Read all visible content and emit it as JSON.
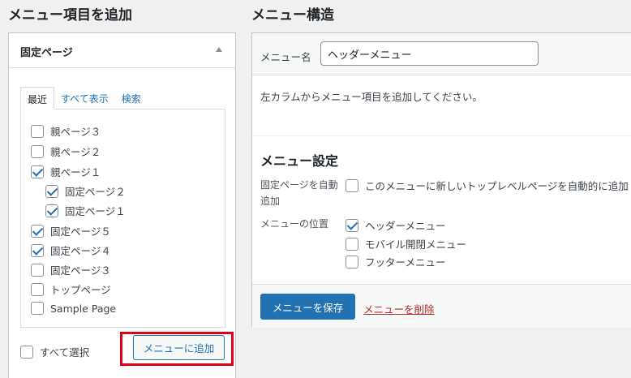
{
  "left": {
    "title": "メニュー項目を追加",
    "panel_title": "固定ページ",
    "tabs": [
      {
        "label": "最近",
        "active": true
      },
      {
        "label": "すべて表示",
        "active": false
      },
      {
        "label": "検索",
        "active": false
      }
    ],
    "pages": [
      {
        "label": "親ページ３",
        "checked": false,
        "indent": 0
      },
      {
        "label": "親ページ２",
        "checked": false,
        "indent": 0
      },
      {
        "label": "親ページ１",
        "checked": true,
        "indent": 0
      },
      {
        "label": "固定ページ２",
        "checked": true,
        "indent": 1
      },
      {
        "label": "固定ページ１",
        "checked": true,
        "indent": 1
      },
      {
        "label": "固定ページ５",
        "checked": true,
        "indent": 0
      },
      {
        "label": "固定ページ４",
        "checked": true,
        "indent": 0
      },
      {
        "label": "固定ページ３",
        "checked": false,
        "indent": 0
      },
      {
        "label": "トップページ",
        "checked": false,
        "indent": 0
      },
      {
        "label": "Sample Page",
        "checked": false,
        "indent": 0
      }
    ],
    "select_all_label": "すべて選択",
    "add_button_label": "メニューに追加"
  },
  "right": {
    "title": "メニュー構造",
    "menu_name_label": "メニュー名",
    "menu_name_value": "ヘッダーメニュー",
    "instructions": "左カラムからメニュー項目を追加してください。",
    "settings_title": "メニュー設定",
    "auto_add_label": "固定ページを自動追加",
    "auto_add_option": "このメニューに新しいトップレベルページを自動的に追加",
    "location_label": "メニューの位置",
    "locations": [
      {
        "label": "ヘッダーメニュー",
        "checked": true
      },
      {
        "label": "モバイル開閉メニュー",
        "checked": false
      },
      {
        "label": "フッターメニュー",
        "checked": false
      }
    ],
    "save_button_label": "メニューを保存",
    "delete_link_label": "メニューを削除"
  },
  "colors": {
    "primary": "#2271b1",
    "danger": "#b32d2e",
    "highlight": "#e0001b"
  }
}
